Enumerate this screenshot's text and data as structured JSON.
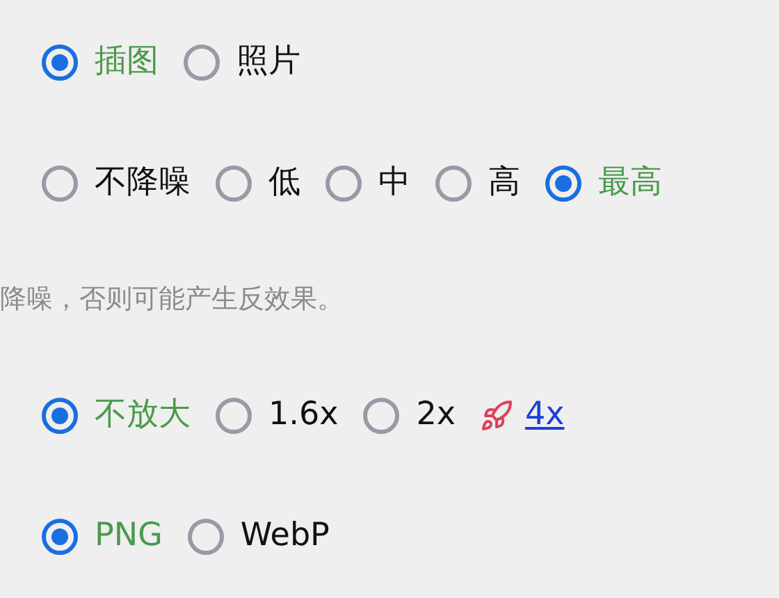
{
  "style_options": [
    {
      "label": "插图",
      "selected": true
    },
    {
      "label": "照片",
      "selected": false
    }
  ],
  "denoise_options": [
    {
      "label": "不降噪",
      "selected": false
    },
    {
      "label": "低",
      "selected": false
    },
    {
      "label": "中",
      "selected": false
    },
    {
      "label": "高",
      "selected": false
    },
    {
      "label": "最高",
      "selected": true
    }
  ],
  "denoise_hint": "降噪，否则可能产生反效果。",
  "scale_options": [
    {
      "label": "不放大",
      "selected": true
    },
    {
      "label": "1.6x",
      "selected": false
    },
    {
      "label": "2x",
      "selected": false
    }
  ],
  "scale_link": "4x",
  "format_options": [
    {
      "label": "PNG",
      "selected": true
    },
    {
      "label": "WebP",
      "selected": false
    }
  ]
}
